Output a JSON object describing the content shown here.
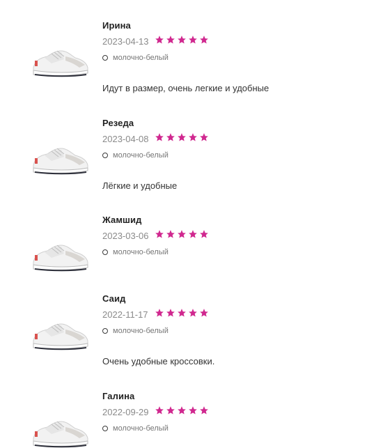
{
  "reviews": [
    {
      "author": "Ирина",
      "date": "2023-04-13",
      "rating": 5,
      "variant": "молочно-белый",
      "text": "Идут в размер, очень легкие и удобные",
      "thumbnail": "sneaker-image"
    },
    {
      "author": "Резеда",
      "date": "2023-04-08",
      "rating": 5,
      "variant": "молочно-белый",
      "text": "Лёгкие и удобные",
      "thumbnail": "sneaker-image"
    },
    {
      "author": "Жамшид",
      "date": "2023-03-06",
      "rating": 5,
      "variant": "молочно-белый",
      "text": "",
      "thumbnail": "sneaker-image"
    },
    {
      "author": "Саид",
      "date": "2022-11-17",
      "rating": 5,
      "variant": "молочно-белый",
      "text": "Очень удобные кроссовки.",
      "thumbnail": "sneaker-image"
    },
    {
      "author": "Галина",
      "date": "2022-09-29",
      "rating": 5,
      "variant": "молочно-белый",
      "text": "",
      "thumbnail": "sneaker-image"
    }
  ],
  "colors": {
    "star": "#d0288f",
    "text": "#333333",
    "muted": "#8a8a8a"
  }
}
